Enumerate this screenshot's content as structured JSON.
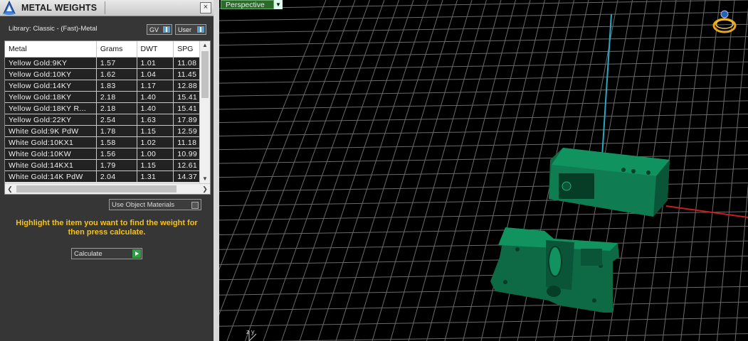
{
  "panel": {
    "title": "METAL WEIGHTS",
    "close_glyph": "×",
    "library_label": "Library: Classic - (Fast)-Metal",
    "toggles": [
      {
        "label": "GV"
      },
      {
        "label": "User"
      }
    ],
    "columns": [
      "Metal",
      "Grams",
      "DWT",
      "SPG"
    ],
    "rows": [
      [
        "Yellow Gold:9KY",
        "1.57",
        "1.01",
        "11.08"
      ],
      [
        "Yellow Gold:10KY",
        "1.62",
        "1.04",
        "11.45"
      ],
      [
        "Yellow Gold:14KY",
        "1.83",
        "1.17",
        "12.88"
      ],
      [
        "Yellow Gold:18KY",
        "2.18",
        "1.40",
        "15.41"
      ],
      [
        "Yellow Gold:18KY R...",
        "2.18",
        "1.40",
        "15.41"
      ],
      [
        "Yellow Gold:22KY",
        "2.54",
        "1.63",
        "17.89"
      ],
      [
        "White Gold:9K PdW",
        "1.78",
        "1.15",
        "12.59"
      ],
      [
        "White Gold:10KX1",
        "1.58",
        "1.02",
        "11.18"
      ],
      [
        "White Gold:10KW",
        "1.56",
        "1.00",
        "10.99"
      ],
      [
        "White Gold:14KX1",
        "1.79",
        "1.15",
        "12.61"
      ],
      [
        "White Gold:14K PdW",
        "2.04",
        "1.31",
        "14.37"
      ]
    ],
    "use_object_materials": "Use Object Materials",
    "hint": "Highlight the item you want to find the weight for then press calculate.",
    "calculate_label": "Calculate",
    "accent_color": "#f5c21a"
  },
  "viewport": {
    "label": "Perspective",
    "axis_label": "z y"
  }
}
